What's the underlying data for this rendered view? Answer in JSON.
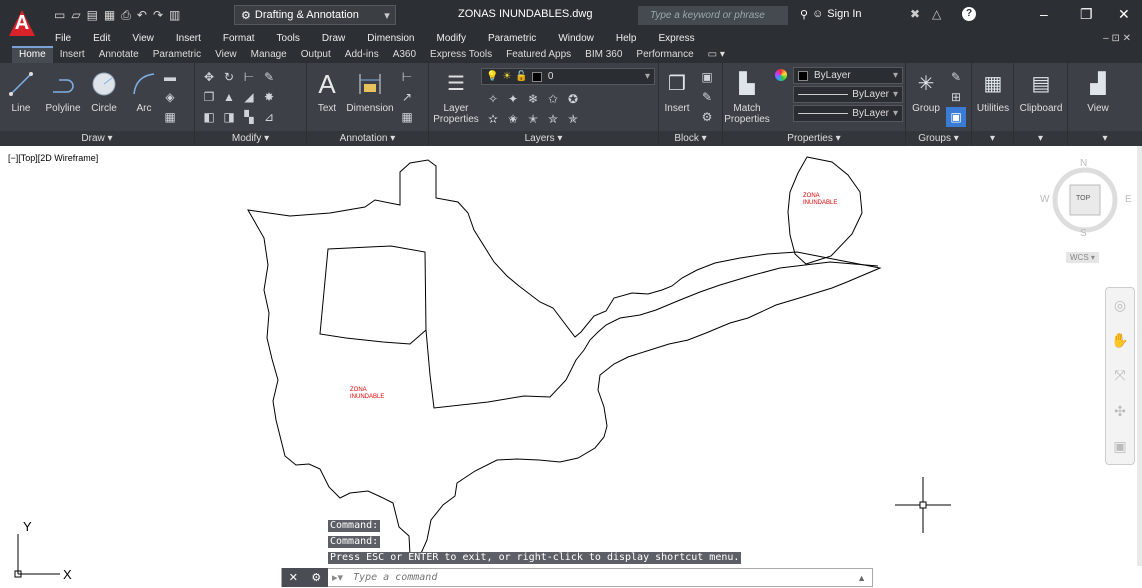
{
  "app": {
    "logo": "A",
    "workspace": "Drafting & Annotation",
    "document_title": "ZONAS INUNDABLES.dwg",
    "search_placeholder": "Type a keyword or phrase",
    "sign_in": "Sign In",
    "help": "?"
  },
  "menubar": [
    "File",
    "Edit",
    "View",
    "Insert",
    "Format",
    "Tools",
    "Draw",
    "Dimension",
    "Modify",
    "Parametric",
    "Window",
    "Help",
    "Express"
  ],
  "tabs": [
    "Home",
    "Insert",
    "Annotate",
    "Parametric",
    "View",
    "Manage",
    "Output",
    "Add-ins",
    "A360",
    "Express Tools",
    "Featured Apps",
    "BIM 360",
    "Performance"
  ],
  "ribbon": {
    "draw": {
      "title": "Draw",
      "line": "Line",
      "polyline": "Polyline",
      "circle": "Circle",
      "arc": "Arc"
    },
    "modify": {
      "title": "Modify"
    },
    "annotation": {
      "title": "Annotation",
      "text": "Text",
      "dimension": "Dimension"
    },
    "layers": {
      "title": "Layers",
      "layer_properties": "Layer Properties",
      "current_layer": "0"
    },
    "block": {
      "title": "Block",
      "insert": "Insert"
    },
    "properties": {
      "title": "Properties",
      "match": "Match Properties",
      "color": "ByLayer",
      "linetype": "ByLayer",
      "lineweight": "ByLayer"
    },
    "groups": {
      "title": "Groups",
      "group": "Group"
    },
    "utilities": "Utilities",
    "clipboard": "Clipboard",
    "view": "View"
  },
  "viewport_label": "[−][Top][2D Wireframe]",
  "drawing": {
    "label1_line1": "ZONA",
    "label1_line2": "INUNDABLE",
    "label2_line1": "ZONA",
    "label2_line2": "INUNDABLE",
    "label_color": "#e00000"
  },
  "viewcube": {
    "n": "N",
    "s": "S",
    "e": "E",
    "w": "W",
    "face": "TOP",
    "wcs": "WCS"
  },
  "ucs": {
    "x": "X",
    "y": "Y"
  },
  "command": {
    "history": [
      "Command:",
      "Command:",
      "Press ESC or ENTER to exit, or right-click to display shortcut menu."
    ],
    "placeholder": "Type a command"
  }
}
